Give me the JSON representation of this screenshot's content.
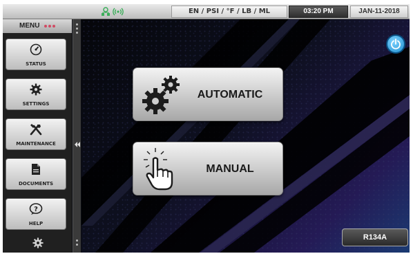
{
  "topbar": {
    "units": "EN / PSI / °F / LB / ML",
    "time": "03:20 PM",
    "date": "JAN-11-2018"
  },
  "sidebar": {
    "title": "MENU",
    "items": [
      {
        "label": "STATUS",
        "icon": "gauge-icon"
      },
      {
        "label": "SETTINGS",
        "icon": "gear-icon"
      },
      {
        "label": "MAINTENANCE",
        "icon": "tools-icon"
      },
      {
        "label": "DOCUMENTS",
        "icon": "document-icon"
      },
      {
        "label": "HELP",
        "icon": "help-icon"
      }
    ]
  },
  "main": {
    "automatic_label": "AUTOMATIC",
    "manual_label": "MANUAL",
    "refrigerant_label": "R134A"
  },
  "colors": {
    "accent_blue": "#1e8fd0",
    "wifi_green": "#3cae5a",
    "menu_dots": "#d14b63"
  }
}
